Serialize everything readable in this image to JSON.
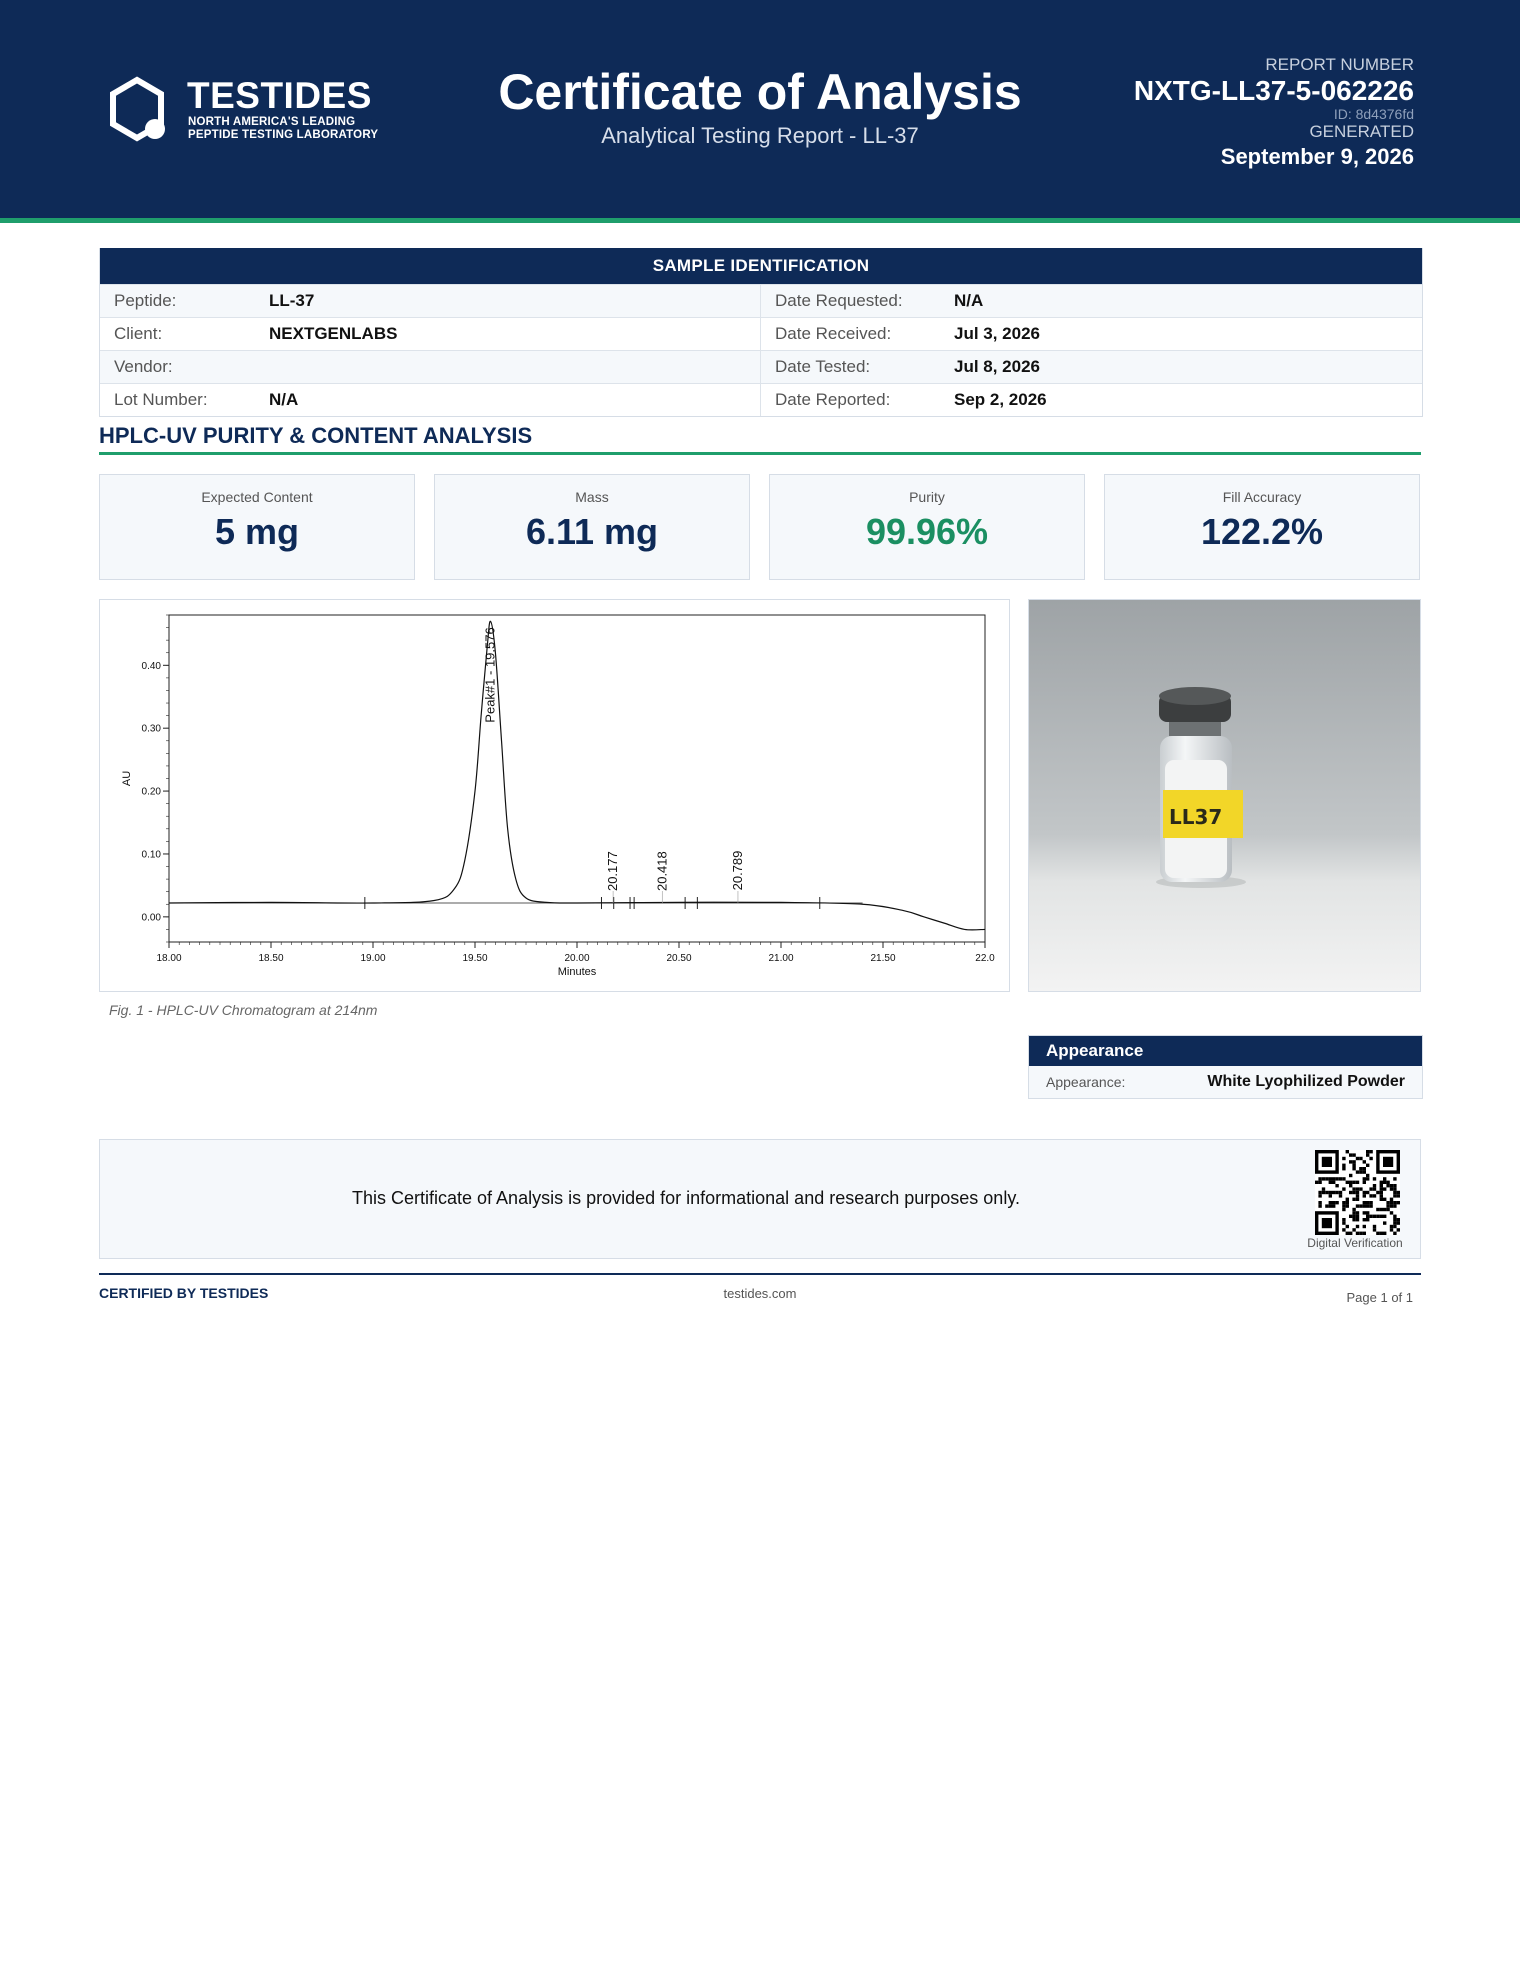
{
  "header": {
    "brand": "TESTIDES",
    "tagline": "NORTH AMERICA'S LEADING\nPEPTIDE TESTING LABORATORY",
    "title": "Certificate of Analysis",
    "subtitle": "Analytical Testing Report  -  LL-37",
    "report_label": "REPORT NUMBER",
    "report_number": "NXTG-LL37-5-062226",
    "report_id": "ID: 8d4376fd",
    "generated_label": "GENERATED",
    "generated_date": "September 9, 2026"
  },
  "sample": {
    "heading": "SAMPLE IDENTIFICATION",
    "rows": [
      {
        "l_label": "Peptide:",
        "l_value": "LL-37",
        "r_label": "Date Requested:",
        "r_value": "N/A"
      },
      {
        "l_label": "Client:",
        "l_value": "NEXTGENLABS",
        "r_label": "Date Received:",
        "r_value": "Jul 3, 2026"
      },
      {
        "l_label": "Vendor:",
        "l_value": "",
        "r_label": "Date Tested:",
        "r_value": "Jul 8, 2026"
      },
      {
        "l_label": "Lot Number:",
        "l_value": "N/A",
        "r_label": "Date Reported:",
        "r_value": "Sep 2, 2026"
      }
    ]
  },
  "analysis": {
    "heading": "HPLC-UV PURITY & CONTENT ANALYSIS",
    "metrics": [
      {
        "label": "Expected Content",
        "value": "5 mg"
      },
      {
        "label": "Mass",
        "value": "6.11 mg"
      },
      {
        "label": "Purity",
        "value": "99.96%"
      },
      {
        "label": "Fill Accuracy",
        "value": "122.2%"
      }
    ],
    "figure_caption": "Fig. 1  -  HPLC-UV Chromatogram at 214nm"
  },
  "chart_data": {
    "type": "line",
    "title": "",
    "xlabel": "Minutes",
    "ylabel": "AU",
    "xlim": [
      18.0,
      22.0
    ],
    "ylim": [
      -0.04,
      0.48
    ],
    "x_ticks": [
      "18.00",
      "18.50",
      "19.00",
      "19.50",
      "20.00",
      "20.50",
      "21.00",
      "21.50",
      "22.0"
    ],
    "y_ticks": [
      "0.00",
      "0.10",
      "0.20",
      "0.30",
      "0.40"
    ],
    "grid": false,
    "series": [
      {
        "x": [
          18.0,
          18.5,
          19.0,
          19.3,
          19.4,
          19.45,
          19.5,
          19.53,
          19.56,
          19.576,
          19.6,
          19.63,
          19.66,
          19.7,
          19.75,
          19.85,
          20.0,
          20.5,
          21.0,
          21.4,
          21.6,
          21.7,
          21.8,
          21.9,
          22.0
        ],
        "y": [
          0.022,
          0.023,
          0.022,
          0.026,
          0.045,
          0.09,
          0.2,
          0.32,
          0.43,
          0.47,
          0.42,
          0.28,
          0.14,
          0.06,
          0.03,
          0.023,
          0.022,
          0.023,
          0.023,
          0.02,
          0.01,
          0.0,
          -0.01,
          -0.02,
          -0.02
        ]
      }
    ],
    "peak_labels": [
      {
        "x": 19.576,
        "y": 0.47,
        "text": "Peak#1 - 19.576"
      },
      {
        "x": 20.177,
        "y": 0.022,
        "text": "20.177"
      },
      {
        "x": 20.418,
        "y": 0.022,
        "text": "20.418"
      },
      {
        "x": 20.789,
        "y": 0.023,
        "text": "20.789"
      }
    ],
    "integration_marks": [
      18.96,
      20.12,
      20.18,
      20.26,
      20.28,
      20.53,
      20.59,
      21.19
    ]
  },
  "appearance": {
    "heading": "Appearance",
    "label": "Appearance:",
    "value": "White Lyophilized Powder"
  },
  "photo": {
    "vial_label": "LL37"
  },
  "disclaimer": {
    "text": "This Certificate of Analysis is provided for informational and research purposes only.",
    "qr_label": "Digital Verification"
  },
  "footer": {
    "left": "CERTIFIED BY TESTIDES",
    "center": "testides.com",
    "right": "Page 1 of 1"
  },
  "colors": {
    "navy": "#0e2a57",
    "green": "#1f9e6c",
    "purity_green": "#1b8f62"
  }
}
